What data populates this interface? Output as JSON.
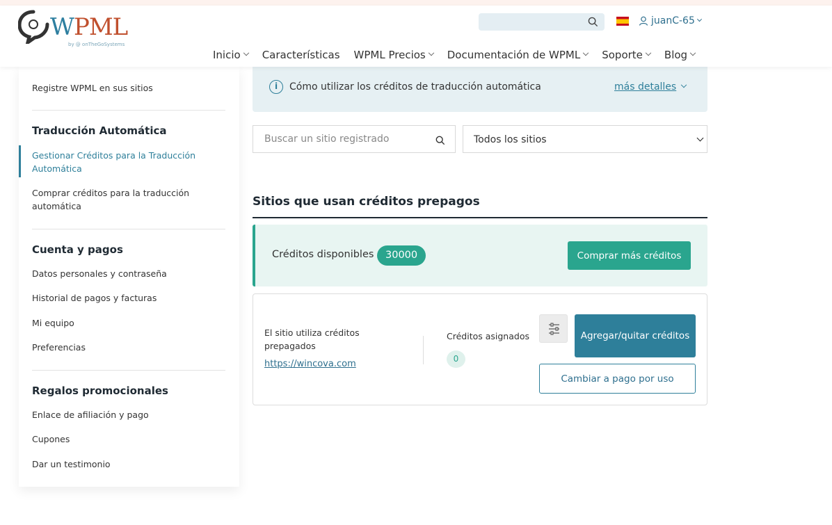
{
  "header": {
    "logo_prefix": "W",
    "logo_suffix": "PML",
    "logo_by": "by @ onTheGoSystems",
    "search_icon": "search-icon",
    "language_flag": "spain-flag-icon",
    "username": "juanC-65",
    "nav": [
      {
        "label": "Inicio",
        "has_dropdown": true
      },
      {
        "label": "Características",
        "has_dropdown": false
      },
      {
        "label": "WPML Precios",
        "has_dropdown": true
      },
      {
        "label": "Documentación de WPML",
        "has_dropdown": true
      },
      {
        "label": "Soporte",
        "has_dropdown": true
      },
      {
        "label": "Blog",
        "has_dropdown": true
      }
    ]
  },
  "sidebar": {
    "register_sites": "Registre WPML en sus sitios",
    "auto_translation_heading": "Traducción Automática",
    "manage_credits": "Gestionar Créditos para la Traducción Automática",
    "buy_credits": "Comprar créditos para la traducción automática",
    "account_heading": "Cuenta y pagos",
    "personal_data": "Datos personales y contraseña",
    "payment_history": "Historial de pagos y facturas",
    "my_team": "Mi equipo",
    "preferences": "Preferencias",
    "promo_heading": "Regalos promocionales",
    "affiliate_link": "Enlace de afiliación y pago",
    "coupons": "Cupones",
    "testimonial": "Dar un testimonio"
  },
  "main": {
    "info_text": "Cómo utilizar los créditos de traducción automática",
    "info_link": "más detalles",
    "search_placeholder": "Buscar un sitio registrado",
    "site_filter": "Todos los sitios",
    "section_title": "Sitios que usan créditos prepagos",
    "credits_label": "Créditos disponibles",
    "credits_value": "30000",
    "buy_more": "Comprar más créditos",
    "site_uses": "El sitio utiliza créditos prepagados",
    "site_url": "https://wincova.com",
    "assigned_label": "Créditos asignados",
    "assigned_value": "0",
    "add_remove": "Agregar/quitar créditos",
    "switch_payg": "Cambiar a pago por uso"
  },
  "colors": {
    "accent_teal": "#2aa58e",
    "accent_blue": "#2e7f9a",
    "logo_blue": "#2e7fa0",
    "logo_red": "#c0502e"
  }
}
